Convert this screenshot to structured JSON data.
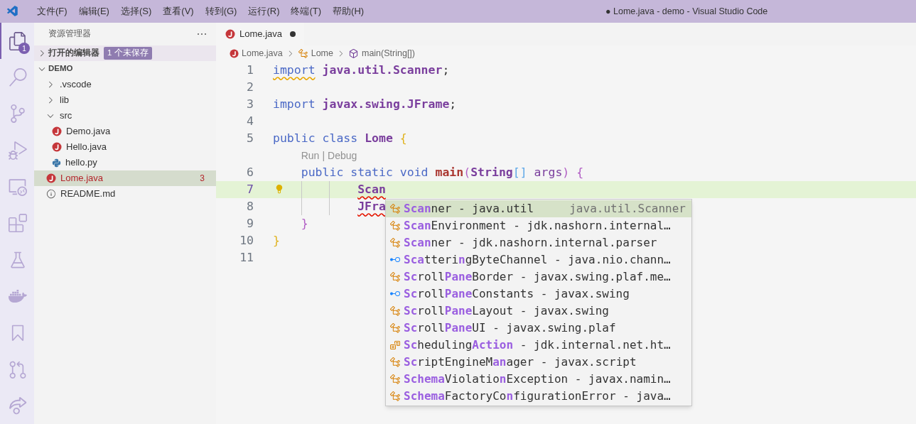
{
  "window": {
    "title": "● Lome.java - demo - Visual Studio Code"
  },
  "menu": [
    "文件(F)",
    "编辑(E)",
    "选择(S)",
    "查看(V)",
    "转到(G)",
    "运行(R)",
    "终端(T)",
    "帮助(H)"
  ],
  "activity_bar": [
    {
      "kind": "explorer",
      "selected": true,
      "badge": "1"
    },
    {
      "kind": "search",
      "selected": false
    },
    {
      "kind": "source-control",
      "selected": false
    },
    {
      "kind": "run-debug",
      "selected": false
    },
    {
      "kind": "remote",
      "selected": false
    },
    {
      "kind": "extensions",
      "selected": false
    },
    {
      "kind": "testing",
      "selected": false
    },
    {
      "kind": "docker",
      "selected": false
    },
    {
      "kind": "bookmarks",
      "selected": false
    },
    {
      "kind": "pull-requests",
      "selected": false
    },
    {
      "kind": "live-share",
      "selected": false
    }
  ],
  "sidebar": {
    "title": "资源管理器",
    "sections": [
      {
        "title": "打开的编辑器",
        "expanded": false,
        "badge": "1 个未保存"
      },
      {
        "title": "DEMO",
        "expanded": true,
        "items": [
          {
            "name": ".vscode",
            "kind": "folder",
            "expanded": false,
            "selected": false
          },
          {
            "name": "lib",
            "kind": "folder",
            "expanded": false,
            "selected": false
          },
          {
            "name": "src",
            "kind": "folder",
            "expanded": true,
            "selected": false,
            "children": [
              {
                "name": "Demo.java",
                "kind": "java",
                "selected": false
              },
              {
                "name": "Hello.java",
                "kind": "java",
                "selected": false
              },
              {
                "name": "hello.py",
                "kind": "python",
                "selected": false
              }
            ]
          },
          {
            "name": "Lome.java",
            "kind": "java",
            "selected": true,
            "error": true,
            "problems": "3"
          },
          {
            "name": "README.md",
            "kind": "info",
            "selected": false
          }
        ]
      }
    ]
  },
  "editor": {
    "tabs": [
      {
        "label": "Lome.java",
        "kind": "java",
        "selected": true,
        "modified": true
      }
    ],
    "breadcrumbs": [
      {
        "text": "Lome.java",
        "kind": "java"
      },
      {
        "text": "Lome",
        "kind": "class"
      },
      {
        "text": "main(String[])",
        "kind": "method"
      }
    ],
    "lines": [
      {
        "number": "1",
        "current": false,
        "tokens": [
          {
            "text": "import",
            "kind": "keyword",
            "warning": true
          },
          {
            "text": " java.util.Scanner",
            "kind": "type"
          },
          {
            "text": ";"
          }
        ]
      },
      {
        "number": "2",
        "current": false
      },
      {
        "number": "3",
        "current": false,
        "tokens": [
          {
            "text": "import",
            "kind": "keyword"
          },
          {
            "text": " javax.swing.JFrame",
            "kind": "type"
          },
          {
            "text": ";"
          }
        ]
      },
      {
        "number": "4",
        "current": false
      },
      {
        "number": "5",
        "current": false,
        "tokens": [
          {
            "text": "public class",
            "kind": "keyword"
          },
          {
            "text": " Lome",
            "kind": "type"
          },
          {
            "text": " {",
            "kind": "bracket1"
          }
        ]
      },
      {
        "number": "6",
        "current": false,
        "codelens": {
          "items": [
            "Run",
            "Debug"
          ],
          "separator": "|"
        },
        "tokens": [
          {
            "text": "    public static void",
            "kind": "keyword"
          },
          {
            "text": " main",
            "kind": "method"
          },
          {
            "text": "(",
            "kind": "bracket2"
          },
          {
            "text": "String",
            "kind": "type"
          },
          {
            "text": "[]",
            "kind": "bracket3"
          },
          {
            "text": " args",
            "kind": "param"
          },
          {
            "text": ")",
            "kind": "bracket2"
          },
          {
            "text": " {",
            "kind": "bracket2"
          }
        ]
      },
      {
        "number": "7",
        "current": true,
        "lightbulb": true,
        "tokens": [
          {
            "text": "            Scan",
            "kind": "type",
            "error": true
          }
        ]
      },
      {
        "number": "8",
        "current": false,
        "tokens": [
          {
            "text": "            JFra",
            "kind": "type",
            "error": true
          }
        ]
      },
      {
        "number": "9",
        "current": false,
        "tokens": [
          {
            "text": "    }",
            "kind": "bracket2"
          }
        ]
      },
      {
        "number": "10",
        "current": false,
        "tokens": [
          {
            "text": "}",
            "kind": "bracket1"
          }
        ]
      },
      {
        "number": "11",
        "current": false
      }
    ],
    "suggestions": [
      {
        "kind": "class",
        "selected": true,
        "label": "**Scan**ner - java.util",
        "detail": "java.util.Scanner"
      },
      {
        "kind": "class",
        "selected": false,
        "label": "**Scan**Environment - jdk.nashorn.internal…"
      },
      {
        "kind": "class",
        "selected": false,
        "label": "**Scan**ner - jdk.nashorn.internal.parser"
      },
      {
        "kind": "interface",
        "selected": false,
        "label": "**Sca**tteri**n**gByteChannel - java.nio.chann…"
      },
      {
        "kind": "class",
        "selected": false,
        "label": "**Sc**roll**Pane**Border - javax.swing.plaf.me…"
      },
      {
        "kind": "interface",
        "selected": false,
        "label": "**Sc**roll**Pane**Constants - javax.swing"
      },
      {
        "kind": "class",
        "selected": false,
        "label": "**Sc**roll**Pane**Layout - javax.swing"
      },
      {
        "kind": "class",
        "selected": false,
        "label": "**Sc**roll**Pane**UI - javax.swing.plaf"
      },
      {
        "kind": "enum",
        "selected": false,
        "label": "**Sc**heduling**Action** - jdk.internal.net.ht…"
      },
      {
        "kind": "class",
        "selected": false,
        "label": "**Sc**riptEngineM**an**ager - javax.script"
      },
      {
        "kind": "class",
        "selected": false,
        "label": "**Schema**Violatio**n**Exception - javax.namin…"
      },
      {
        "kind": "class",
        "selected": false,
        "label": "**Schema**FactoryCo**n**figurationError - java…"
      }
    ]
  }
}
